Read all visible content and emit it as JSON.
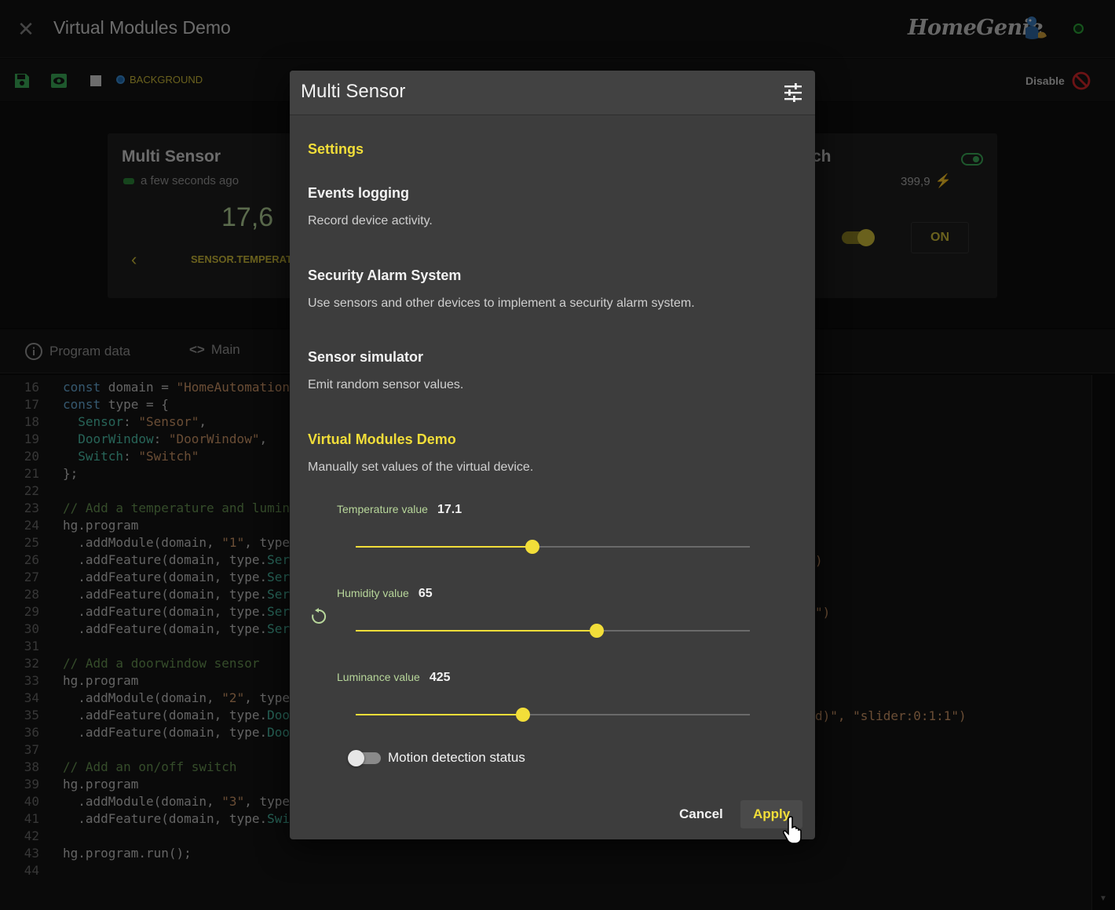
{
  "app": {
    "title": "Virtual Modules Demo",
    "brand": "HomeGenie"
  },
  "toolbar": {
    "background_label": "BACKGROUND",
    "disable_label": "Disable"
  },
  "preview": {
    "card1": {
      "title": "Multi Sensor",
      "time": "a few seconds ago",
      "value": "17,6",
      "field": "SENSOR.TEMPERATU"
    },
    "card2": {
      "title_fragment": "ch",
      "power": "399,9",
      "state_button": "ON",
      "switch_on": true
    }
  },
  "tabs": [
    {
      "label": "Program data",
      "icon": "info-icon"
    },
    {
      "label": "Main",
      "icon": "code-icon"
    }
  ],
  "code": {
    "lines": [
      {
        "n": "16",
        "html": "<span class=\"kw\">const</span> domain = <span class=\"str\">\"HomeAutomation</span>"
      },
      {
        "n": "17",
        "html": "<span class=\"kw\">const</span> type = {"
      },
      {
        "n": "18",
        "html": "  <span class=\"prop\">Sensor</span>: <span class=\"str\">\"Sensor\"</span>,"
      },
      {
        "n": "19",
        "html": "  <span class=\"prop\">DoorWindow</span>: <span class=\"str\">\"DoorWindow\"</span>,"
      },
      {
        "n": "20",
        "html": "  <span class=\"prop\">Switch</span>: <span class=\"str\">\"Switch\"</span>"
      },
      {
        "n": "21",
        "html": "};"
      },
      {
        "n": "22",
        "html": ""
      },
      {
        "n": "23",
        "html": "<span class=\"cm\">// Add a temperature and lumin</span>"
      },
      {
        "n": "24",
        "html": "hg.program"
      },
      {
        "n": "25",
        "html": "  .addModule(domain, <span class=\"str\">\"1\"</span>, type"
      },
      {
        "n": "26",
        "html": "  .addFeature(domain, type.<span class=\"prop\">Ser</span>"
      },
      {
        "n": "27",
        "html": "  .addFeature(domain, type.<span class=\"prop\">Ser</span>"
      },
      {
        "n": "28",
        "html": "  .addFeature(domain, type.<span class=\"prop\">Ser</span>"
      },
      {
        "n": "29",
        "html": "  .addFeature(domain, type.<span class=\"prop\">Ser</span>"
      },
      {
        "n": "30",
        "html": "  .addFeature(domain, type.<span class=\"prop\">Ser</span>"
      },
      {
        "n": "31",
        "html": ""
      },
      {
        "n": "32",
        "html": "<span class=\"cm\">// Add a doorwindow sensor</span>"
      },
      {
        "n": "33",
        "html": "hg.program"
      },
      {
        "n": "34",
        "html": "  .addModule(domain, <span class=\"str\">\"2\"</span>, type"
      },
      {
        "n": "35",
        "html": "  .addFeature(domain, type.<span class=\"prop\">Doo</span>"
      },
      {
        "n": "36",
        "html": "  .addFeature(domain, type.<span class=\"prop\">Doo</span>"
      },
      {
        "n": "37",
        "html": ""
      },
      {
        "n": "38",
        "html": "<span class=\"cm\">// Add an on/off switch</span>"
      },
      {
        "n": "39",
        "html": "hg.program"
      },
      {
        "n": "40",
        "html": "  .addModule(domain, <span class=\"str\">\"3\"</span>, type"
      },
      {
        "n": "41",
        "html": "  .addFeature(domain, type.<span class=\"prop\">Swi</span>"
      },
      {
        "n": "42",
        "html": ""
      },
      {
        "n": "43",
        "html": "hg.program.run();"
      },
      {
        "n": "44",
        "html": ""
      }
    ],
    "right_fragments": [
      {
        "line": "26",
        "text": ")"
      },
      {
        "line": "29",
        "text": "\")"
      },
      {
        "line": "35",
        "text": "d)\", \"slider:0:1:1\")"
      }
    ]
  },
  "dialog": {
    "title": "Multi Sensor",
    "settings_heading": "Settings",
    "items": [
      {
        "title": "Events logging",
        "desc": "Record device activity."
      },
      {
        "title": "Security Alarm System",
        "desc": "Use sensors and other devices to implement a security alarm system."
      },
      {
        "title": "Sensor simulator",
        "desc": "Emit random sensor values."
      }
    ],
    "program_heading": "Virtual Modules Demo",
    "program_desc": "Manually set values of the virtual device.",
    "sliders": [
      {
        "label": "Temperature value",
        "value": "17.1",
        "fraction": 0.448
      },
      {
        "label": "Humidity value",
        "value": "65",
        "fraction": 0.612
      },
      {
        "label": "Luminance value",
        "value": "425",
        "fraction": 0.425
      }
    ],
    "toggle_label": "Motion detection status",
    "toggle_on": false,
    "cancel_label": "Cancel",
    "apply_label": "Apply"
  },
  "colors": {
    "accent": "#f2de39",
    "background": "#141414",
    "dialog": "#3d3d3d"
  }
}
